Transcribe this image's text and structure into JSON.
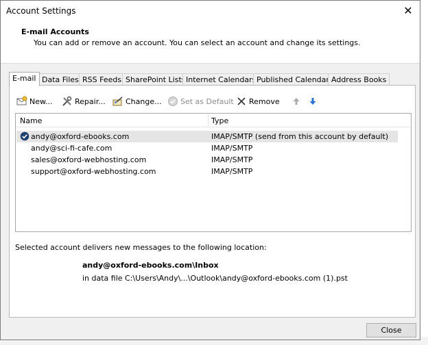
{
  "window": {
    "title": "Account Settings",
    "close_glyph": "✕"
  },
  "header": {
    "title": "E-mail Accounts",
    "description": "You can add or remove an account. You can select an account and change its settings."
  },
  "tabs": [
    {
      "label": "E-mail",
      "active": true
    },
    {
      "label": "Data Files"
    },
    {
      "label": "RSS Feeds"
    },
    {
      "label": "SharePoint Lists"
    },
    {
      "label": "Internet Calendars"
    },
    {
      "label": "Published Calendars"
    },
    {
      "label": "Address Books"
    }
  ],
  "toolbar": {
    "new": "New...",
    "repair": "Repair...",
    "change": "Change...",
    "set_default": "Set as Default",
    "remove": "Remove"
  },
  "table": {
    "columns": [
      "Name",
      "Type"
    ],
    "rows": [
      {
        "name": "andy@oxford-ebooks.com",
        "type": "IMAP/SMTP (send from this account by default)",
        "default": true
      },
      {
        "name": "andy@sci-fi-cafe.com",
        "type": "IMAP/SMTP"
      },
      {
        "name": "sales@oxford-webhosting.com",
        "type": "IMAP/SMTP"
      },
      {
        "name": "support@oxford-webhosting.com",
        "type": "IMAP/SMTP"
      }
    ]
  },
  "delivery": {
    "label": "Selected account delivers new messages to the following location:",
    "folder": "andy@oxford-ebooks.com\\Inbox",
    "data_file": "in data file C:\\Users\\Andy\\...\\Outlook\\andy@oxford-ebooks.com (1).pst"
  },
  "buttons": {
    "close": "Close"
  },
  "colors": {
    "accent_arrow": "#2a72d4",
    "default_badge": "#1f3f6e",
    "selected_row": "#e5e5e5"
  }
}
